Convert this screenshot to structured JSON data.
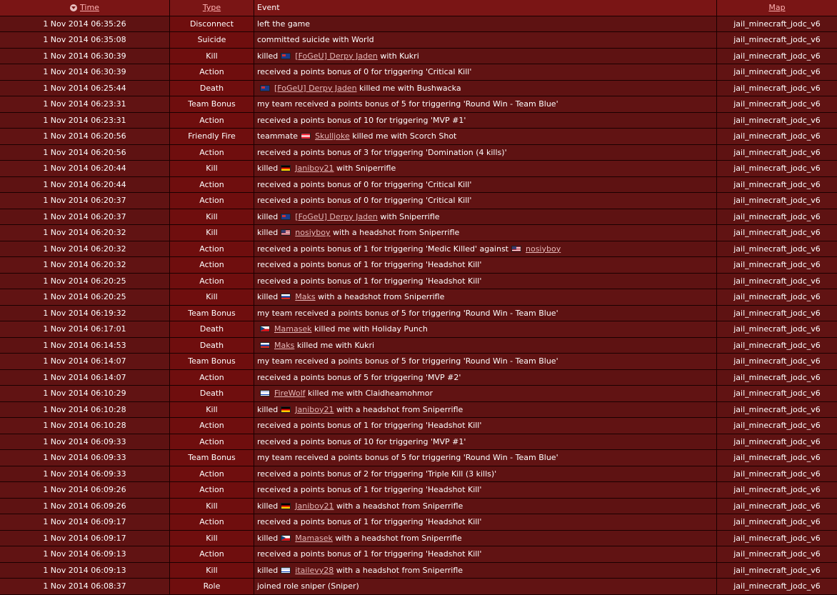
{
  "header": {
    "time": "Time",
    "type": "Type",
    "event": "Event",
    "map": "Map"
  },
  "rows": [
    {
      "time": "1 Nov 2014 06:35:26",
      "type": "Disconnect",
      "event": [
        {
          "t": "left the game"
        }
      ],
      "map": "jail_minecraft_jodc_v6"
    },
    {
      "time": "1 Nov 2014 06:35:08",
      "type": "Suicide",
      "event": [
        {
          "t": "committed suicide with World"
        }
      ],
      "map": "jail_minecraft_jodc_v6"
    },
    {
      "time": "1 Nov 2014 06:30:39",
      "type": "Kill",
      "event": [
        {
          "t": "killed"
        },
        {
          "flag": "au"
        },
        {
          "p": "[FoGeU] Derpy Jaden"
        },
        {
          "t": " with Kukri"
        }
      ],
      "map": "jail_minecraft_jodc_v6"
    },
    {
      "time": "1 Nov 2014 06:30:39",
      "type": "Action",
      "event": [
        {
          "t": "received a points bonus of 0 for triggering 'Critical Kill'"
        }
      ],
      "map": "jail_minecraft_jodc_v6"
    },
    {
      "time": "1 Nov 2014 06:25:44",
      "type": "Death",
      "event": [
        {
          "flag": "au"
        },
        {
          "p": "[FoGeU] Derpy Jaden"
        },
        {
          "t": " killed me with Bushwacka"
        }
      ],
      "map": "jail_minecraft_jodc_v6"
    },
    {
      "time": "1 Nov 2014 06:23:31",
      "type": "Team Bonus",
      "event": [
        {
          "t": "my team received a points bonus of 5 for triggering 'Round Win - Team Blue'"
        }
      ],
      "map": "jail_minecraft_jodc_v6"
    },
    {
      "time": "1 Nov 2014 06:23:31",
      "type": "Action",
      "event": [
        {
          "t": "received a points bonus of 10 for triggering 'MVP #1'"
        }
      ],
      "map": "jail_minecraft_jodc_v6"
    },
    {
      "time": "1 Nov 2014 06:20:56",
      "type": "Friendly Fire",
      "event": [
        {
          "t": "teammate"
        },
        {
          "flag": "at"
        },
        {
          "p": "Skulljoke"
        },
        {
          "t": " killed me with Scorch Shot"
        }
      ],
      "map": "jail_minecraft_jodc_v6"
    },
    {
      "time": "1 Nov 2014 06:20:56",
      "type": "Action",
      "event": [
        {
          "t": "received a points bonus of 3 for triggering 'Domination (4 kills)'"
        }
      ],
      "map": "jail_minecraft_jodc_v6"
    },
    {
      "time": "1 Nov 2014 06:20:44",
      "type": "Kill",
      "event": [
        {
          "t": "killed"
        },
        {
          "flag": "de"
        },
        {
          "p": "Janiboy21"
        },
        {
          "t": " with Sniperrifle"
        }
      ],
      "map": "jail_minecraft_jodc_v6"
    },
    {
      "time": "1 Nov 2014 06:20:44",
      "type": "Action",
      "event": [
        {
          "t": "received a points bonus of 0 for triggering 'Critical Kill'"
        }
      ],
      "map": "jail_minecraft_jodc_v6"
    },
    {
      "time": "1 Nov 2014 06:20:37",
      "type": "Action",
      "event": [
        {
          "t": "received a points bonus of 0 for triggering 'Critical Kill'"
        }
      ],
      "map": "jail_minecraft_jodc_v6"
    },
    {
      "time": "1 Nov 2014 06:20:37",
      "type": "Kill",
      "event": [
        {
          "t": "killed"
        },
        {
          "flag": "au"
        },
        {
          "p": "[FoGeU] Derpy Jaden"
        },
        {
          "t": " with Sniperrifle"
        }
      ],
      "map": "jail_minecraft_jodc_v6"
    },
    {
      "time": "1 Nov 2014 06:20:32",
      "type": "Kill",
      "event": [
        {
          "t": "killed"
        },
        {
          "flag": "us"
        },
        {
          "p": "nosiyboy"
        },
        {
          "t": " with a headshot from Sniperrifle"
        }
      ],
      "map": "jail_minecraft_jodc_v6"
    },
    {
      "time": "1 Nov 2014 06:20:32",
      "type": "Action",
      "event": [
        {
          "t": "received a points bonus of 1 for triggering 'Medic Killed' against"
        },
        {
          "flag": "us"
        },
        {
          "p": "nosiyboy"
        }
      ],
      "map": "jail_minecraft_jodc_v6"
    },
    {
      "time": "1 Nov 2014 06:20:32",
      "type": "Action",
      "event": [
        {
          "t": "received a points bonus of 1 for triggering 'Headshot Kill'"
        }
      ],
      "map": "jail_minecraft_jodc_v6"
    },
    {
      "time": "1 Nov 2014 06:20:25",
      "type": "Action",
      "event": [
        {
          "t": "received a points bonus of 1 for triggering 'Headshot Kill'"
        }
      ],
      "map": "jail_minecraft_jodc_v6"
    },
    {
      "time": "1 Nov 2014 06:20:25",
      "type": "Kill",
      "event": [
        {
          "t": "killed"
        },
        {
          "flag": "ru"
        },
        {
          "p": "Maks"
        },
        {
          "t": " with a headshot from Sniperrifle"
        }
      ],
      "map": "jail_minecraft_jodc_v6"
    },
    {
      "time": "1 Nov 2014 06:19:32",
      "type": "Team Bonus",
      "event": [
        {
          "t": "my team received a points bonus of 5 for triggering 'Round Win - Team Blue'"
        }
      ],
      "map": "jail_minecraft_jodc_v6"
    },
    {
      "time": "1 Nov 2014 06:17:01",
      "type": "Death",
      "event": [
        {
          "flag": "cz"
        },
        {
          "p": "Mamasek"
        },
        {
          "t": " killed me with Holiday Punch"
        }
      ],
      "map": "jail_minecraft_jodc_v6"
    },
    {
      "time": "1 Nov 2014 06:14:53",
      "type": "Death",
      "event": [
        {
          "flag": "ru"
        },
        {
          "p": "Maks"
        },
        {
          "t": " killed me with Kukri"
        }
      ],
      "map": "jail_minecraft_jodc_v6"
    },
    {
      "time": "1 Nov 2014 06:14:07",
      "type": "Team Bonus",
      "event": [
        {
          "t": "my team received a points bonus of 5 for triggering 'Round Win - Team Blue'"
        }
      ],
      "map": "jail_minecraft_jodc_v6"
    },
    {
      "time": "1 Nov 2014 06:14:07",
      "type": "Action",
      "event": [
        {
          "t": "received a points bonus of 5 for triggering 'MVP #2'"
        }
      ],
      "map": "jail_minecraft_jodc_v6"
    },
    {
      "time": "1 Nov 2014 06:10:29",
      "type": "Death",
      "event": [
        {
          "flag": "il"
        },
        {
          "p": "FireWolf"
        },
        {
          "t": " killed me with Claidheamohmor"
        }
      ],
      "map": "jail_minecraft_jodc_v6"
    },
    {
      "time": "1 Nov 2014 06:10:28",
      "type": "Kill",
      "event": [
        {
          "t": "killed"
        },
        {
          "flag": "de"
        },
        {
          "p": "Janiboy21"
        },
        {
          "t": " with a headshot from Sniperrifle"
        }
      ],
      "map": "jail_minecraft_jodc_v6"
    },
    {
      "time": "1 Nov 2014 06:10:28",
      "type": "Action",
      "event": [
        {
          "t": "received a points bonus of 1 for triggering 'Headshot Kill'"
        }
      ],
      "map": "jail_minecraft_jodc_v6"
    },
    {
      "time": "1 Nov 2014 06:09:33",
      "type": "Action",
      "event": [
        {
          "t": "received a points bonus of 10 for triggering 'MVP #1'"
        }
      ],
      "map": "jail_minecraft_jodc_v6"
    },
    {
      "time": "1 Nov 2014 06:09:33",
      "type": "Team Bonus",
      "event": [
        {
          "t": "my team received a points bonus of 5 for triggering 'Round Win - Team Blue'"
        }
      ],
      "map": "jail_minecraft_jodc_v6"
    },
    {
      "time": "1 Nov 2014 06:09:33",
      "type": "Action",
      "event": [
        {
          "t": "received a points bonus of 2 for triggering 'Triple Kill (3 kills)'"
        }
      ],
      "map": "jail_minecraft_jodc_v6"
    },
    {
      "time": "1 Nov 2014 06:09:26",
      "type": "Action",
      "event": [
        {
          "t": "received a points bonus of 1 for triggering 'Headshot Kill'"
        }
      ],
      "map": "jail_minecraft_jodc_v6"
    },
    {
      "time": "1 Nov 2014 06:09:26",
      "type": "Kill",
      "event": [
        {
          "t": "killed"
        },
        {
          "flag": "de"
        },
        {
          "p": "Janiboy21"
        },
        {
          "t": " with a headshot from Sniperrifle"
        }
      ],
      "map": "jail_minecraft_jodc_v6"
    },
    {
      "time": "1 Nov 2014 06:09:17",
      "type": "Action",
      "event": [
        {
          "t": "received a points bonus of 1 for triggering 'Headshot Kill'"
        }
      ],
      "map": "jail_minecraft_jodc_v6"
    },
    {
      "time": "1 Nov 2014 06:09:17",
      "type": "Kill",
      "event": [
        {
          "t": "killed"
        },
        {
          "flag": "cz"
        },
        {
          "p": "Mamasek"
        },
        {
          "t": " with a headshot from Sniperrifle"
        }
      ],
      "map": "jail_minecraft_jodc_v6"
    },
    {
      "time": "1 Nov 2014 06:09:13",
      "type": "Action",
      "event": [
        {
          "t": "received a points bonus of 1 for triggering 'Headshot Kill'"
        }
      ],
      "map": "jail_minecraft_jodc_v6"
    },
    {
      "time": "1 Nov 2014 06:09:13",
      "type": "Kill",
      "event": [
        {
          "t": "killed"
        },
        {
          "flag": "il"
        },
        {
          "p": "itailevy28"
        },
        {
          "t": " with a headshot from Sniperrifle"
        }
      ],
      "map": "jail_minecraft_jodc_v6"
    },
    {
      "time": "1 Nov 2014 06:08:37",
      "type": "Role",
      "event": [
        {
          "t": "joined role sniper (Sniper)"
        }
      ],
      "map": "jail_minecraft_jodc_v6"
    }
  ],
  "flag_icons": {
    "au": "australia-flag-icon",
    "at": "austria-flag-icon",
    "de": "germany-flag-icon",
    "us": "usa-flag-icon",
    "ru": "russia-flag-icon",
    "cz": "czech-flag-icon",
    "il": "israel-flag-icon"
  },
  "colors": {
    "header_bg": "#7a1515",
    "row_bg": "#5e1212",
    "type_bg": "#6f0e0e",
    "link": "#e6b8b8"
  }
}
